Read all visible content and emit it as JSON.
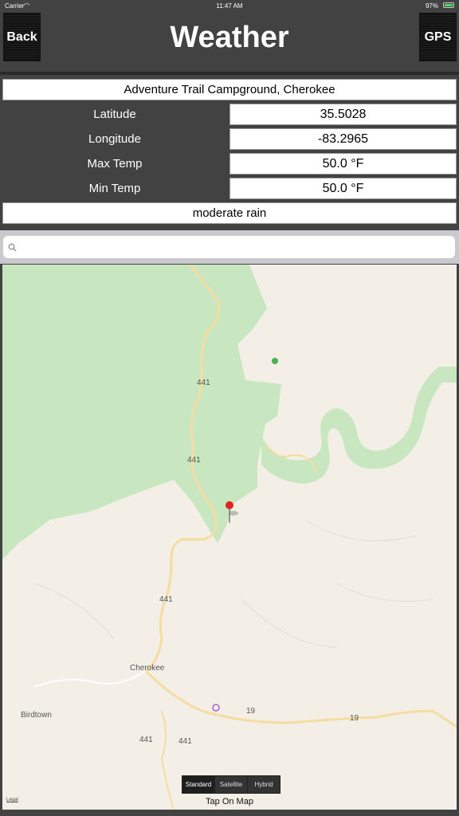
{
  "status_bar": {
    "carrier": "Carrier",
    "time": "11:47 AM",
    "battery": "97%"
  },
  "nav": {
    "back_label": "Back",
    "title": "Weather",
    "gps_label": "GPS"
  },
  "info": {
    "location": "Adventure Trail Campground, Cherokee",
    "rows": [
      {
        "label": "Latitude",
        "value": "35.5028"
      },
      {
        "label": "Longitude",
        "value": "-83.2965"
      },
      {
        "label": "Max Temp",
        "value": "50.0 °F"
      },
      {
        "label": "Min Temp",
        "value": "50.0 °F"
      }
    ],
    "condition": "moderate rain"
  },
  "search": {
    "placeholder": ""
  },
  "map": {
    "places": [
      "Cherokee",
      "Birdtown"
    ],
    "route_shields": [
      "441",
      "441",
      "441",
      "441",
      "441",
      "19",
      "19"
    ],
    "map_types": [
      "Standard",
      "Satellite",
      "Hybrid"
    ],
    "selected_map_type": "Standard",
    "tap_hint": "Tap On Map",
    "legal": "Legal",
    "colors": {
      "land": "#f3efe6",
      "park": "#c8e6c0",
      "road": "#f6dca0"
    }
  }
}
